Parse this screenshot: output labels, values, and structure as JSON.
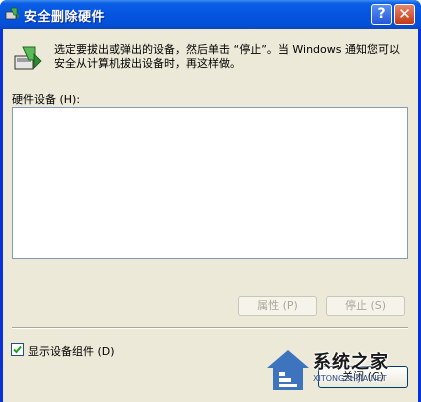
{
  "window": {
    "title": "安全删除硬件",
    "help_glyph": "?",
    "close_glyph": "✕"
  },
  "intro": {
    "text": "选定要拔出或弹出的设备，然后单击 “停止”。当 Windows  通知您可以安全从计算机拔出设备时，再这样做。"
  },
  "device_list": {
    "label": "硬件设备 (H):",
    "items": []
  },
  "buttons": {
    "properties": "属性 (P)",
    "stop": "停止 (S)",
    "close": "关闭 (C)"
  },
  "checkbox": {
    "label": "显示设备组件 (D)",
    "checked": true,
    "check_glyph": "✓"
  },
  "watermark": {
    "name": "系统之家",
    "url": "XITONGZHIJIA.NET"
  },
  "colors": {
    "titlebar": "#0554e0",
    "client": "#ece9d8",
    "list_border": "#7f9db9",
    "disabled_text": "#aca899"
  },
  "icons": {
    "title": "hardware-icon",
    "dialog": "hardware-eject-icon"
  }
}
